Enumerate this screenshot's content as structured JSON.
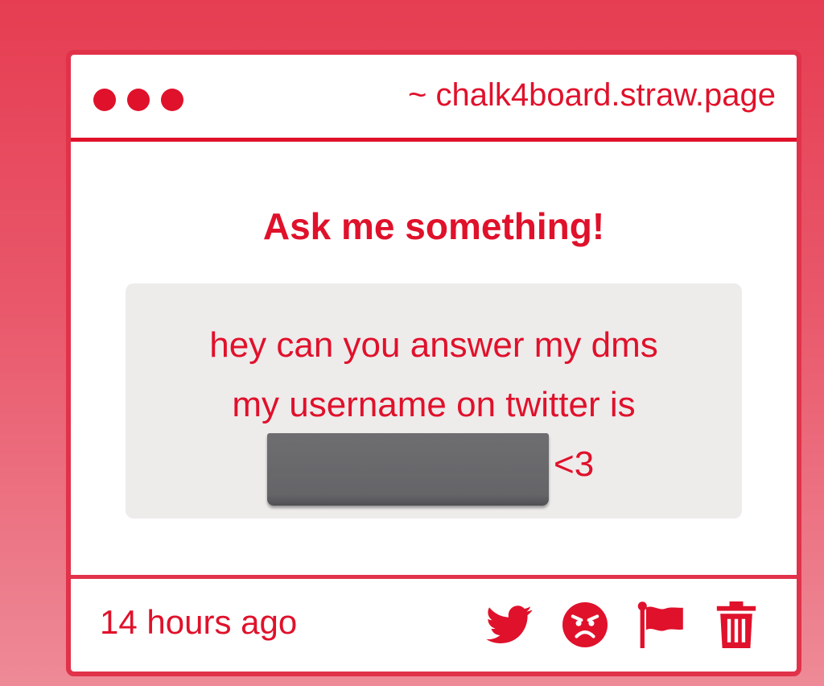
{
  "window": {
    "url": "~ chalk4board.straw.page"
  },
  "main": {
    "heading": "Ask me something!",
    "question": {
      "line1": "hey can you answer my dms",
      "line2": "my username on twitter is",
      "suffix": "<3"
    }
  },
  "footer": {
    "timestamp": "14 hours ago",
    "icons": [
      "twitter-icon",
      "angry-face-icon",
      "flag-icon",
      "trash-icon"
    ]
  },
  "colors": {
    "accent": "#e0112b",
    "background_top": "#e63d52",
    "background_bottom": "#ee8a97",
    "question_box": "#eeebeb",
    "redaction": "#6b6a6d"
  }
}
